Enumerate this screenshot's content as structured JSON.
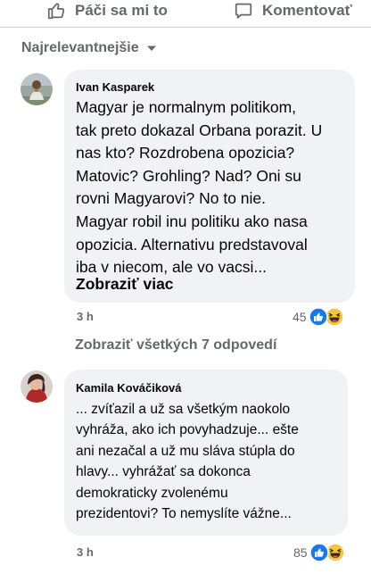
{
  "action_bar": {
    "like_label": "Páči sa mi to",
    "comment_label": "Komentovať",
    "like_icon": "thumbs-up-outline-icon",
    "comment_icon": "speech-bubble-outline-icon"
  },
  "sort": {
    "label": "Najrelevantnejšie",
    "icon": "caret-down-icon"
  },
  "comments": [
    {
      "author": "Ivan Kasparek",
      "lines": [
        "Magyar je normalnym politikom,",
        "tak preto dokazal Orbana porazit. U",
        "nas kto? Rozdrobena opozicia?",
        "Matovic? Grohling? Nad? Oni su",
        "rovni Magyarovi? No to nie.",
        "Magyar robil inu politiku ako nasa",
        "opozicia. Alternativu predstavoval",
        "iba v niecom, ale vo vacsi..."
      ],
      "see_more": "Zobraziť viac",
      "time": "3 h",
      "reaction_count": "45",
      "reaction_icons": [
        "like-reaction-icon",
        "haha-reaction-icon"
      ]
    },
    {
      "author": "Kamila Kováčiková",
      "lines": [
        "... zvíťazil a už sa všetkým naokolo",
        "vyhráža, ako ich povyhadzuje... ešte",
        "ani nezačal a už mu sláva stúpla do",
        "hlavy... vyhrážať sa dokonca",
        "demokraticky zvolenému",
        "prezidentovi? To nemyslíte vážne..."
      ],
      "time": "3 h",
      "reaction_count": "85",
      "reaction_icons": [
        "like-reaction-icon",
        "haha-reaction-icon"
      ]
    }
  ],
  "view_replies": "Zobraziť všetkých 7 odpovedí",
  "colors": {
    "secondary_text": "#65676b",
    "bubble_bg": "#f0f2f5",
    "like_blue": "#1877f2",
    "haha_yellow": "#f7c53c"
  }
}
